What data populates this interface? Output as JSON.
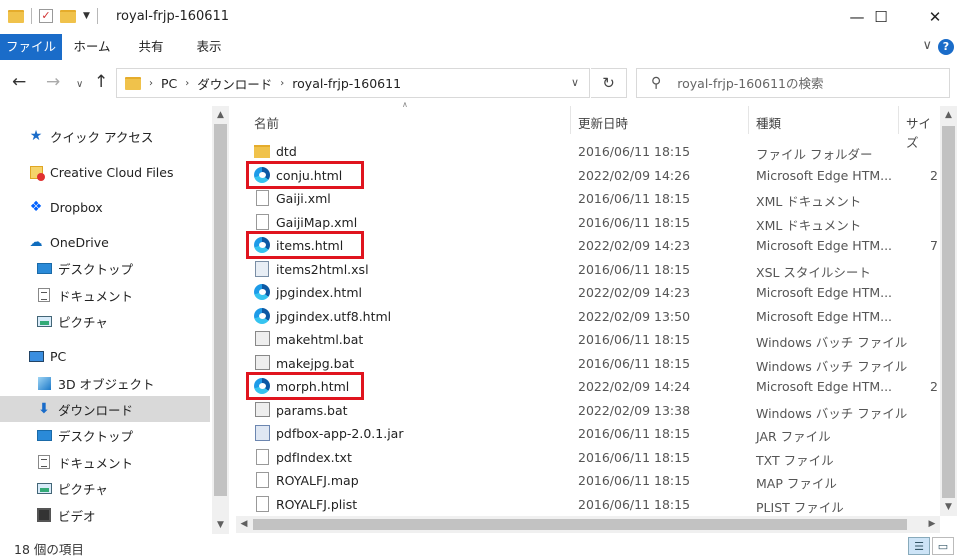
{
  "window": {
    "title": "royal-frjp-160611",
    "minimize_label": "—",
    "maximize_label": "☐",
    "close_label": "✕"
  },
  "ribbon": {
    "tabs": [
      "ファイル",
      "ホーム",
      "共有",
      "表示"
    ],
    "help_label": "?",
    "collapse_label": "∨"
  },
  "nav": {
    "back_label": "←",
    "forward_label": "→",
    "up_label": "↑",
    "breadcrumb": [
      "PC",
      "ダウンロード",
      "royal-frjp-160611"
    ],
    "refresh_label": "↻",
    "search_placeholder": "royal-frjp-160611の検索"
  },
  "sidebar": {
    "items": [
      {
        "label": "クイック アクセス",
        "icon": "star-icon"
      },
      {
        "label": "Creative Cloud Files",
        "icon": "creative-cloud-icon"
      },
      {
        "label": "Dropbox",
        "icon": "dropbox-icon"
      },
      {
        "label": "OneDrive",
        "icon": "onedrive-icon"
      },
      {
        "label": "デスクトップ",
        "icon": "desktop-icon"
      },
      {
        "label": "ドキュメント",
        "icon": "documents-icon"
      },
      {
        "label": "ピクチャ",
        "icon": "pictures-icon"
      },
      {
        "label": "PC",
        "icon": "pc-icon"
      },
      {
        "label": "3D オブジェクト",
        "icon": "3d-objects-icon"
      },
      {
        "label": "ダウンロード",
        "icon": "download-icon",
        "selected": true
      },
      {
        "label": "デスクトップ",
        "icon": "desktop-icon"
      },
      {
        "label": "ドキュメント",
        "icon": "documents-icon"
      },
      {
        "label": "ピクチャ",
        "icon": "pictures-icon"
      },
      {
        "label": "ビデオ",
        "icon": "video-icon"
      }
    ]
  },
  "columns": {
    "name": "名前",
    "date": "更新日時",
    "type": "種類",
    "size": "サイズ"
  },
  "files": [
    {
      "name": "dtd",
      "date": "2016/06/11 18:15",
      "type": "ファイル フォルダー",
      "size": "",
      "icon": "folder-icon"
    },
    {
      "name": "conju.html",
      "date": "2022/02/09 14:26",
      "type": "Microsoft Edge HTM...",
      "size": "2",
      "icon": "edge-icon",
      "highlight": true
    },
    {
      "name": "Gaiji.xml",
      "date": "2016/06/11 18:15",
      "type": "XML ドキュメント",
      "size": "",
      "icon": "document-icon"
    },
    {
      "name": "GaijiMap.xml",
      "date": "2016/06/11 18:15",
      "type": "XML ドキュメント",
      "size": "",
      "icon": "document-icon"
    },
    {
      "name": "items.html",
      "date": "2022/02/09 14:23",
      "type": "Microsoft Edge HTM...",
      "size": "7",
      "icon": "edge-icon",
      "highlight": true
    },
    {
      "name": "items2html.xsl",
      "date": "2016/06/11 18:15",
      "type": "XSL スタイルシート",
      "size": "",
      "icon": "xsl-icon"
    },
    {
      "name": "jpgindex.html",
      "date": "2022/02/09 14:23",
      "type": "Microsoft Edge HTM...",
      "size": "",
      "icon": "edge-icon"
    },
    {
      "name": "jpgindex.utf8.html",
      "date": "2022/02/09 13:50",
      "type": "Microsoft Edge HTM...",
      "size": "",
      "icon": "edge-icon"
    },
    {
      "name": "makehtml.bat",
      "date": "2016/06/11 18:15",
      "type": "Windows バッチ ファイル",
      "size": "",
      "icon": "batch-icon"
    },
    {
      "name": "makejpg.bat",
      "date": "2016/06/11 18:15",
      "type": "Windows バッチ ファイル",
      "size": "",
      "icon": "batch-icon"
    },
    {
      "name": "morph.html",
      "date": "2022/02/09 14:24",
      "type": "Microsoft Edge HTM...",
      "size": "2",
      "icon": "edge-icon",
      "highlight": true
    },
    {
      "name": "params.bat",
      "date": "2022/02/09 13:38",
      "type": "Windows バッチ ファイル",
      "size": "",
      "icon": "batch-icon"
    },
    {
      "name": "pdfbox-app-2.0.1.jar",
      "date": "2016/06/11 18:15",
      "type": "JAR ファイル",
      "size": "",
      "icon": "jar-icon"
    },
    {
      "name": "pdfIndex.txt",
      "date": "2016/06/11 18:15",
      "type": "TXT ファイル",
      "size": "",
      "icon": "document-icon"
    },
    {
      "name": "ROYALFJ.map",
      "date": "2016/06/11 18:15",
      "type": "MAP ファイル",
      "size": "",
      "icon": "document-icon"
    },
    {
      "name": "ROYALFJ.plist",
      "date": "2016/06/11 18:15",
      "type": "PLIST ファイル",
      "size": "",
      "icon": "document-icon"
    }
  ],
  "status": {
    "item_count": "18 個の項目"
  },
  "colors": {
    "accent": "#1a6cc9",
    "highlight_box": "#e0141e",
    "selected_bg": "#d9d9d9"
  }
}
